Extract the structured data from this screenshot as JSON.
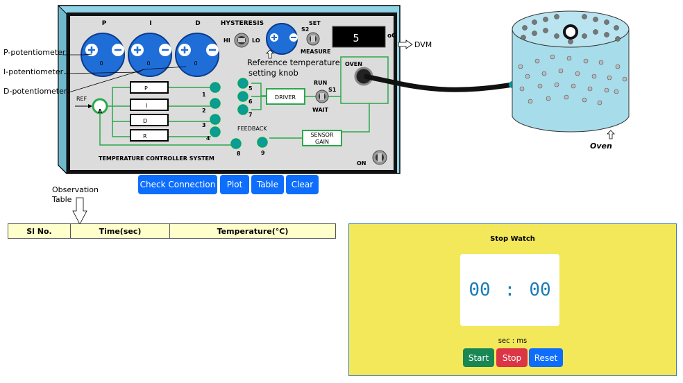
{
  "controller": {
    "knob_p_label": "P",
    "knob_i_label": "I",
    "knob_d_label": "D",
    "knob_p_value": "0",
    "knob_i_value": "0",
    "knob_d_value": "0",
    "hysteresis_label": "HYSTERESIS",
    "hi_label": "HI",
    "lo_label": "LO",
    "s2_label": "S2",
    "set_label": "SET",
    "measure_label": "MEASURE",
    "display_value": "5",
    "display_unit": "oC",
    "oven_label": "OVEN",
    "driver_label": "DRIVER",
    "run_label": "RUN",
    "s1_label": "S1",
    "wait_label": "WAIT",
    "sensor_gain_line1": "SENSOR",
    "sensor_gain_line2": "GAIN",
    "feedback_label": "FEEDBACK",
    "ref_label": "REF",
    "a_label": "A",
    "block_p": "P",
    "block_i": "I",
    "block_d": "D",
    "block_r": "R",
    "node_1": "1",
    "node_2": "2",
    "node_3": "3",
    "node_4": "4",
    "node_5": "5",
    "node_6": "6",
    "node_7": "7",
    "node_8": "8",
    "node_9": "9",
    "system_label": "TEMPERATURE CONTROLLER SYSTEM",
    "on_label": "ON"
  },
  "annotations": {
    "p_pot": "P-potentiometer",
    "i_pot": "I-potentiometer",
    "d_pot": "D-potentiometer",
    "ref_knob_line1": "Reference temperature",
    "ref_knob_line2": "setting knob",
    "dvm": "DVM",
    "oven": "Oven",
    "obs_line1": "Observation",
    "obs_line2": "Table"
  },
  "actions": {
    "check_connection": "Check Connection",
    "plot": "Plot",
    "table": "Table",
    "clear": "Clear"
  },
  "table": {
    "headers": [
      "Sl No.",
      "Time(sec)",
      "Temperature(°C)"
    ]
  },
  "stopwatch": {
    "title": "Stop Watch",
    "minutes": "00",
    "separator": ":",
    "seconds": "00",
    "unit": "sec : ms",
    "start": "Start",
    "stop": "Stop",
    "reset": "Reset"
  },
  "colors": {
    "panel_frame": "#8fd3e6",
    "panel_face": "#dcdcdc",
    "knob_blue": "#1f6ed8",
    "wire_green": "#2aa84a",
    "node_teal": "#0c9a9a",
    "oven_fill": "#a7dcea",
    "table_bg": "#ffffcc",
    "stopwatch_bg": "#f2e85a"
  }
}
